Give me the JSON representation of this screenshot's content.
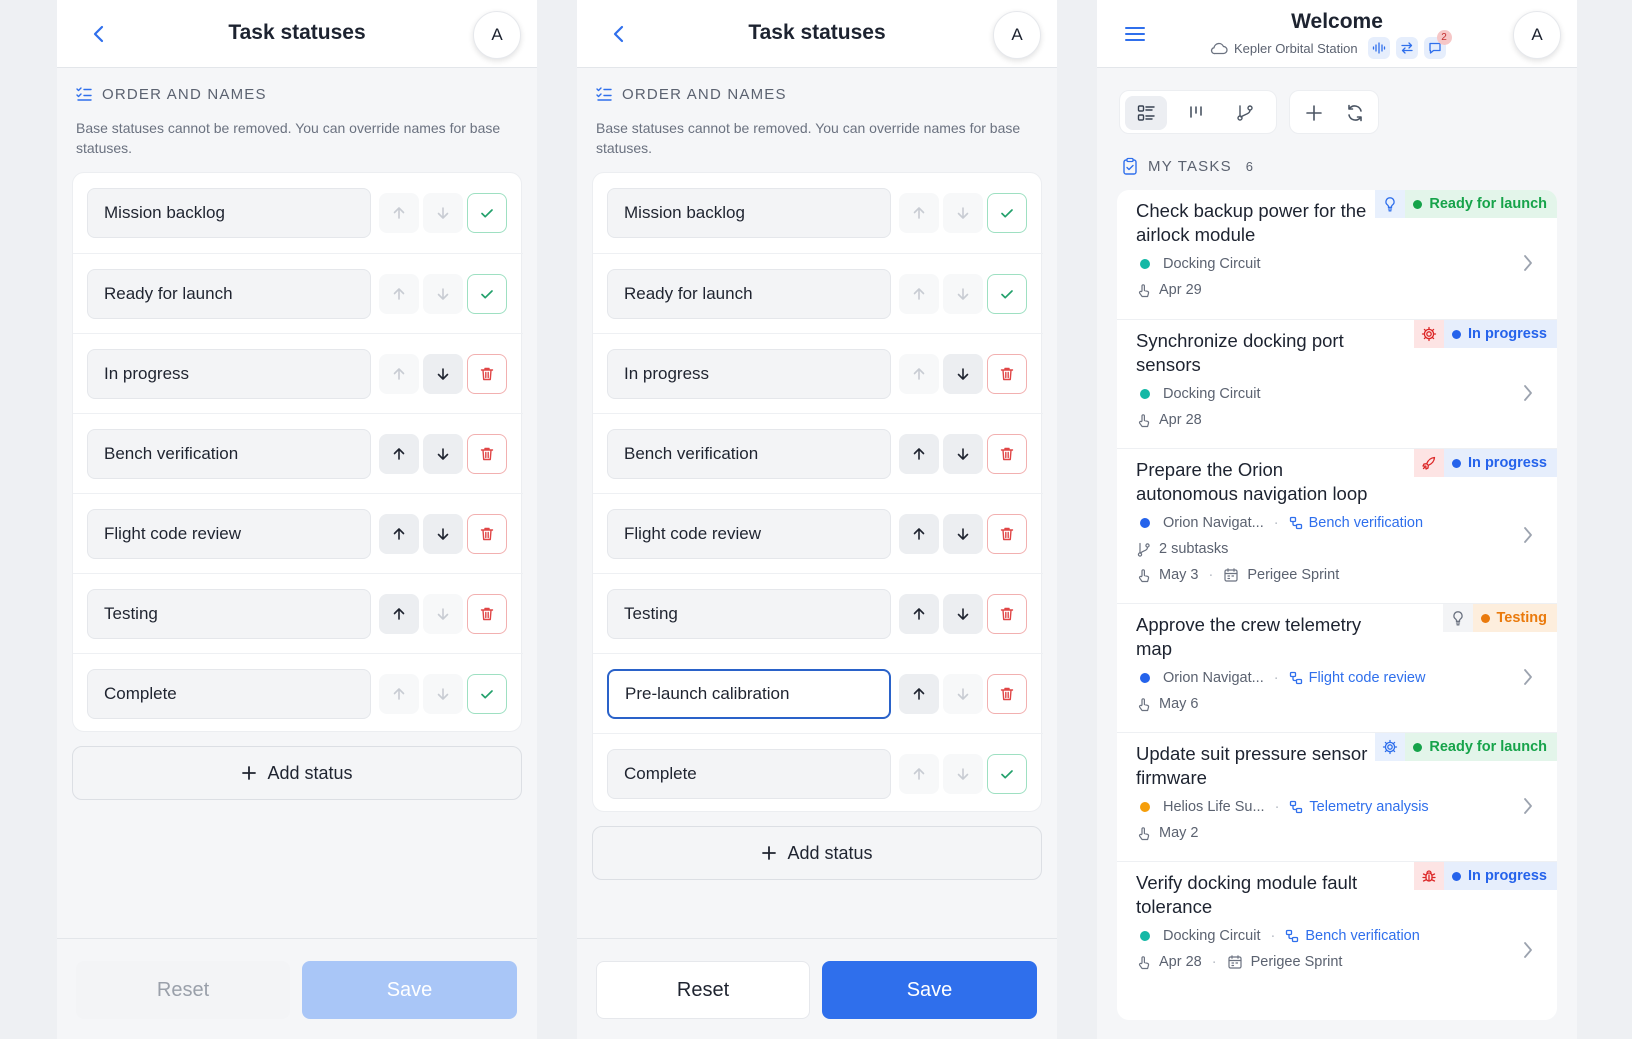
{
  "editor": {
    "title": "Task statuses",
    "avatar": "A",
    "section_title": "ORDER AND NAMES",
    "description": "Base statuses cannot be removed. You can override names for base statuses.",
    "add_status_label": "Add status",
    "reset_label": "Reset",
    "save_label": "Save"
  },
  "panel1": {
    "save_enabled": false,
    "statuses": [
      {
        "name": "Mission backlog",
        "up": false,
        "down": false,
        "action": "check"
      },
      {
        "name": "Ready for launch",
        "up": false,
        "down": false,
        "action": "check"
      },
      {
        "name": "In progress",
        "up": false,
        "down": true,
        "action": "delete"
      },
      {
        "name": "Bench verification",
        "up": true,
        "down": true,
        "action": "delete"
      },
      {
        "name": "Flight code review",
        "up": true,
        "down": true,
        "action": "delete"
      },
      {
        "name": "Testing",
        "up": true,
        "down": false,
        "action": "delete"
      },
      {
        "name": "Complete",
        "up": false,
        "down": false,
        "action": "check"
      }
    ]
  },
  "panel2": {
    "save_enabled": true,
    "statuses": [
      {
        "name": "Mission backlog",
        "up": false,
        "down": false,
        "action": "check"
      },
      {
        "name": "Ready for launch",
        "up": false,
        "down": false,
        "action": "check"
      },
      {
        "name": "In progress",
        "up": false,
        "down": true,
        "action": "delete"
      },
      {
        "name": "Bench verification",
        "up": true,
        "down": true,
        "action": "delete"
      },
      {
        "name": "Flight code review",
        "up": true,
        "down": true,
        "action": "delete"
      },
      {
        "name": "Testing",
        "up": true,
        "down": true,
        "action": "delete"
      },
      {
        "name": "Pre-launch calibration",
        "up": true,
        "down": false,
        "action": "delete",
        "focused": true
      },
      {
        "name": "Complete",
        "up": false,
        "down": false,
        "action": "check"
      }
    ]
  },
  "home": {
    "title": "Welcome",
    "workspace": "Kepler Orbital Station",
    "message_badge": "2",
    "avatar": "A",
    "section_title": "MY TASKS",
    "task_count": "6",
    "tasks": [
      {
        "title": "Check backup power for the airlock module",
        "badge_icon": "lightbulb-icon",
        "status": "Ready for launch",
        "status_color": "#16a34a",
        "badge_bg": "#e3f5ea",
        "icon_color": "#2f6fec",
        "icon_bg": "#e8f0fd",
        "project": "Docking Circuit",
        "project_color": "#14b8a6",
        "link": "",
        "subtasks": "",
        "date": "Apr 29",
        "sprint": ""
      },
      {
        "title": "Synchronize docking port sensors",
        "badge_icon": "gear-icon",
        "status": "In progress",
        "status_color": "#2563eb",
        "badge_bg": "#e6eefc",
        "icon_color": "#dc2626",
        "icon_bg": "#fde4e4",
        "project": "Docking Circuit",
        "project_color": "#14b8a6",
        "link": "",
        "subtasks": "",
        "date": "Apr 28",
        "sprint": ""
      },
      {
        "title": "Prepare the Orion autonomous navigation loop",
        "badge_icon": "rocket-icon",
        "status": "In progress",
        "status_color": "#2563eb",
        "badge_bg": "#e6eefc",
        "icon_color": "#dc2626",
        "icon_bg": "#fde4e4",
        "project": "Orion Navigat...",
        "project_color": "#2563eb",
        "link": "Bench verification",
        "subtasks": "2 subtasks",
        "date": "May 3",
        "sprint": "Perigee Sprint"
      },
      {
        "title": "Approve the crew telemetry map",
        "badge_icon": "lightbulb-icon",
        "status": "Testing",
        "status_color": "#ea7a0c",
        "badge_bg": "#fdeedd",
        "icon_color": "#6b7280",
        "icon_bg": "#f3f4f6",
        "project": "Orion Navigat...",
        "project_color": "#2563eb",
        "link": "Flight code review",
        "subtasks": "",
        "date": "May 6",
        "sprint": ""
      },
      {
        "title": "Update suit pressure sensor firmware",
        "badge_icon": "gear-icon",
        "status": "Ready for launch",
        "status_color": "#16a34a",
        "badge_bg": "#e3f5ea",
        "icon_color": "#2f6fec",
        "icon_bg": "#e8f0fd",
        "project": "Helios Life Su...",
        "project_color": "#f59e0b",
        "link": "Telemetry analysis",
        "subtasks": "",
        "date": "May 2",
        "sprint": ""
      },
      {
        "title": "Verify docking module fault tolerance",
        "badge_icon": "bug-icon",
        "status": "In progress",
        "status_color": "#2563eb",
        "badge_bg": "#e6eefc",
        "icon_color": "#dc2626",
        "icon_bg": "#fde4e4",
        "project": "Docking Circuit",
        "project_color": "#14b8a6",
        "link": "Bench verification",
        "subtasks": "",
        "date": "Apr 28",
        "sprint": "Perigee Sprint"
      }
    ]
  }
}
